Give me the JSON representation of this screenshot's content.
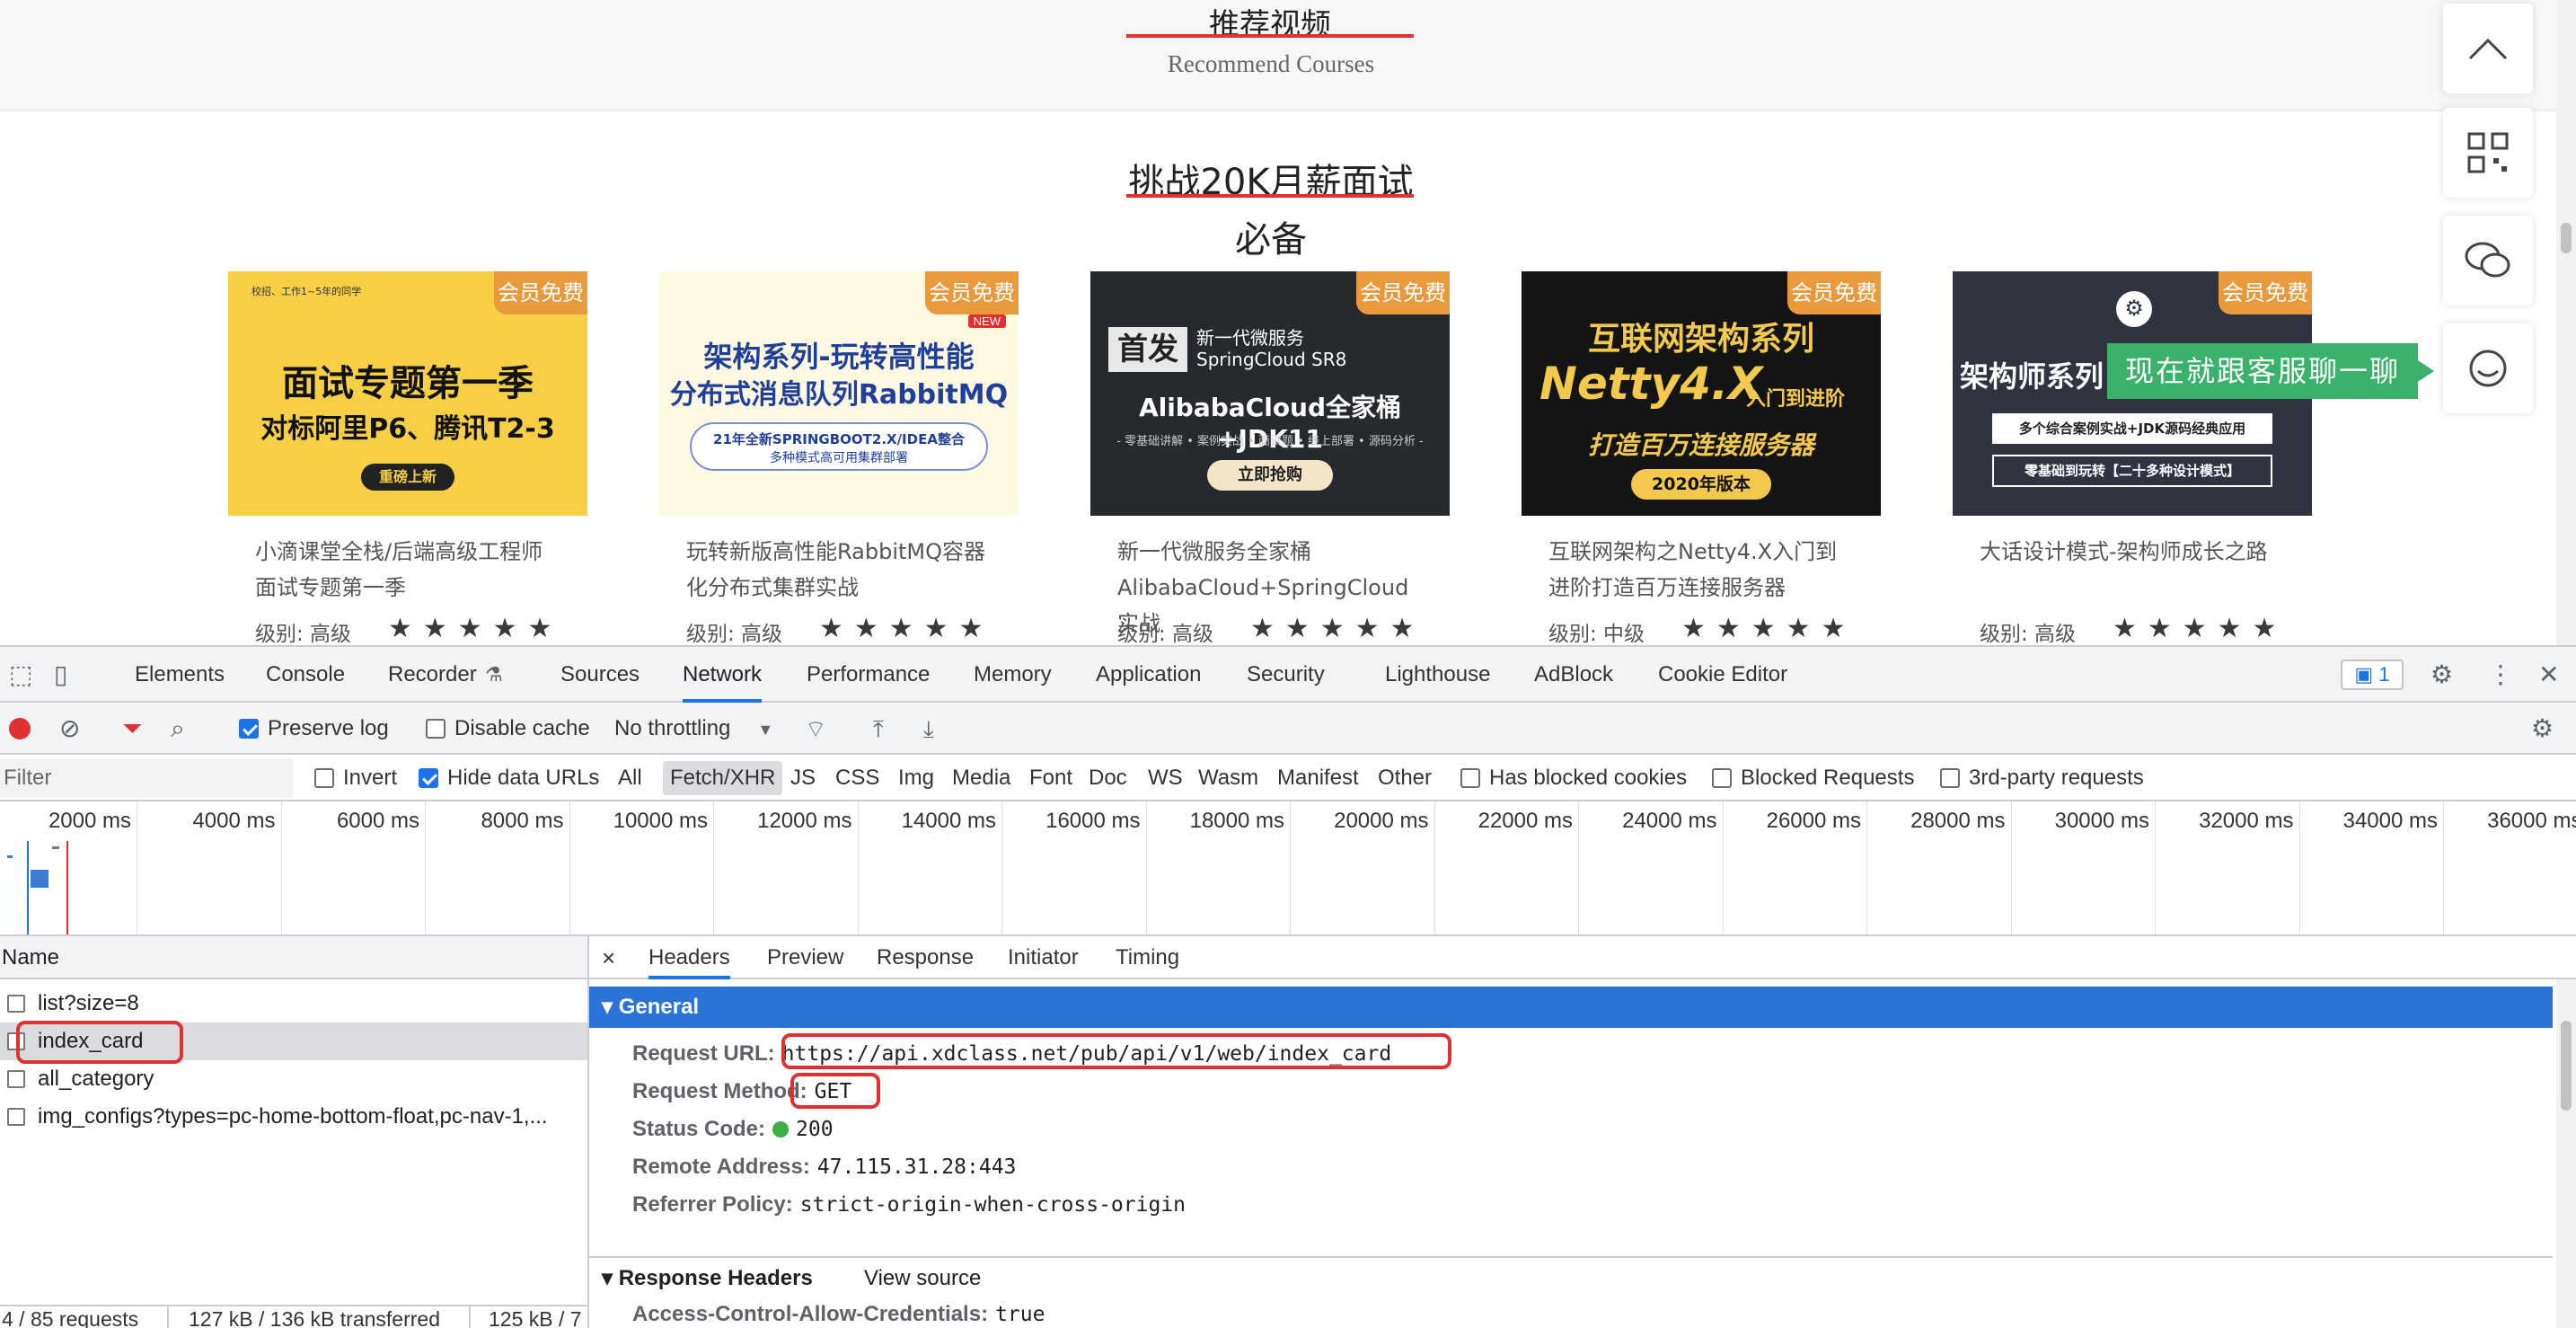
{
  "webpage": {
    "recommend_title": "推荐视频",
    "recommend_subtitle": "Recommend Courses",
    "challenge_title_line1": "挑战20K月薪面试",
    "challenge_title_line2": "必备",
    "chat_tip": "现在就跟客服聊一聊",
    "accent_color": "#e0302f",
    "cards": [
      {
        "badge": "会员免费",
        "thumb_top": "校招、工作1~5年的同学",
        "thumb_line1": "面试专题第一季",
        "thumb_line2": "对标阿里P6、腾讯T2-3",
        "thumb_cta": "重磅上新",
        "name": "小滴课堂全栈/后端高级工程师面试专题第一季",
        "level": "级别: 高级",
        "rating": 5
      },
      {
        "badge": "会员免费",
        "thumb_new": "NEW",
        "thumb_line1": "架构系列-玩转高性能",
        "thumb_line2": "分布式消息队列RabbitMQ",
        "thumb_note1": "21年全新SPRINGBOOT2.X/IDEA整合",
        "thumb_note2": "多种模式高可用集群部署",
        "name": "玩转新版高性能RabbitMQ容器化分布式集群实战",
        "level": "级别: 高级",
        "rating": 5
      },
      {
        "badge": "会员免费",
        "thumb_first": "首发",
        "thumb_line1": "新一代微服务",
        "thumb_line2": "SpringCloud SR8",
        "thumb_line3": "AlibabaCloud全家桶+JDK11",
        "thumb_note": "- 零基础讲解 • 案例实战 • 面试题 • 线上部署 • 源码分析 -",
        "thumb_cta": "立即抢购",
        "name": "新一代微服务全家桶AlibabaCloud+SpringCloud实战",
        "level": "级别: 高级",
        "rating": 5
      },
      {
        "badge": "会员免费",
        "thumb_line1": "互联网架构系列",
        "thumb_line2": "Netty4.X",
        "thumb_line2b": "入门到进阶",
        "thumb_line3": "打造百万连接服务器",
        "thumb_cta": "2020年版本",
        "name": "互联网架构之Netty4.X入门到进阶打造百万连接服务器",
        "level": "级别: 中级",
        "rating": 5
      },
      {
        "badge": "会员免费",
        "thumb_line1": "架构师系列",
        "thumb_note1": "多个综合案例实战+JDK源码经典应用",
        "thumb_note2": "零基础到玩转【二十多种设计模式】",
        "name": "大话设计模式-架构师成长之路",
        "level": "级别: 高级",
        "rating": 5
      }
    ]
  },
  "devtools": {
    "tabs": [
      "Elements",
      "Console",
      "Recorder",
      "Sources",
      "Network",
      "Performance",
      "Memory",
      "Application",
      "Security",
      "Lighthouse",
      "AdBlock",
      "Cookie Editor"
    ],
    "active_tab": "Network",
    "issues_count": "1",
    "toolbar": {
      "preserve_log": "Preserve log",
      "disable_cache": "Disable cache",
      "throttling": "No throttling"
    },
    "filterbar": {
      "filter_placeholder": "Filter",
      "invert": "Invert",
      "hide_data_urls": "Hide data URLs",
      "types": [
        "All",
        "Fetch/XHR",
        "JS",
        "CSS",
        "Img",
        "Media",
        "Font",
        "Doc",
        "WS",
        "Wasm",
        "Manifest",
        "Other"
      ],
      "active_type": "Fetch/XHR",
      "has_blocked_cookies": "Has blocked cookies",
      "blocked_requests": "Blocked Requests",
      "third_party": "3rd-party requests"
    },
    "timeline_ticks": [
      "2000 ms",
      "4000 ms",
      "6000 ms",
      "8000 ms",
      "10000 ms",
      "12000 ms",
      "14000 ms",
      "16000 ms",
      "18000 ms",
      "20000 ms",
      "22000 ms",
      "24000 ms",
      "26000 ms",
      "28000 ms",
      "30000 ms",
      "32000 ms",
      "34000 ms",
      "36000 ms"
    ],
    "request_list": {
      "header": "Name",
      "rows": [
        "list?size=8",
        "index_card",
        "all_category",
        "img_configs?types=pc-home-bottom-float,pc-nav-1,..."
      ],
      "selected": "index_card",
      "status_requests": "4 / 85 requests",
      "status_transferred": "127 kB / 136 kB transferred",
      "status_resources": "125 kB / 7"
    },
    "details": {
      "close": "×",
      "tabs": [
        "Headers",
        "Preview",
        "Response",
        "Initiator",
        "Timing"
      ],
      "active_tab": "Headers",
      "general_label": "General",
      "general": {
        "request_url_label": "Request URL:",
        "request_url": "https://api.xdclass.net/pub/api/v1/web/index_card",
        "request_method_label": "Request Method:",
        "request_method": "GET",
        "status_code_label": "Status Code:",
        "status_code": "200",
        "remote_address_label": "Remote Address:",
        "remote_address": "47.115.31.28:443",
        "referrer_policy_label": "Referrer Policy:",
        "referrer_policy": "strict-origin-when-cross-origin"
      },
      "response_headers_label": "Response Headers",
      "view_source": "View source",
      "acac_label": "Access-Control-Allow-Credentials:",
      "acac_value": "true"
    }
  }
}
